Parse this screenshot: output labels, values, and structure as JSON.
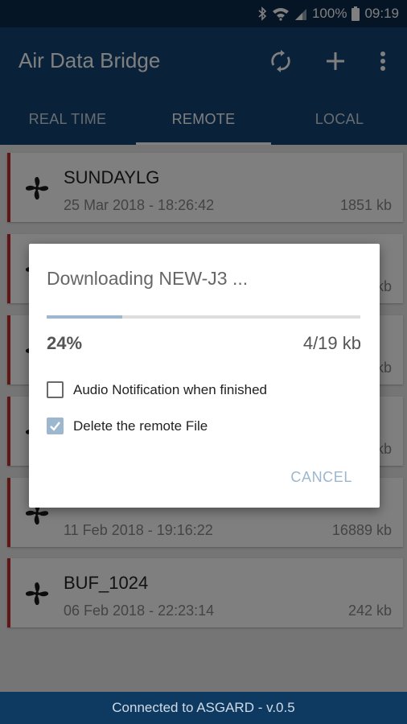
{
  "status_bar": {
    "battery": "100%",
    "time": "09:19"
  },
  "app_bar": {
    "title": "Air Data Bridge",
    "icons": [
      "sync-icon",
      "add-icon",
      "more-vert-icon"
    ]
  },
  "tabs": [
    {
      "label": "REAL TIME",
      "active": false
    },
    {
      "label": "REMOTE",
      "active": true
    },
    {
      "label": "LOCAL",
      "active": false
    }
  ],
  "files": [
    {
      "name": "SUNDAYLG",
      "date": "25 Mar 2018 - 18:26:42",
      "size": "1851 kb"
    },
    {
      "name": "",
      "date": "",
      "size": "kb"
    },
    {
      "name": "",
      "date": "",
      "size": "kb"
    },
    {
      "name": "",
      "date": "",
      "size": "kb"
    },
    {
      "name": "",
      "date": "11 Feb 2018 - 19:16:22",
      "size": "16889 kb"
    },
    {
      "name": "BUF_1024",
      "date": "06 Feb 2018 - 22:23:14",
      "size": "242 kb"
    }
  ],
  "dialog": {
    "title": "Downloading NEW-J3 ...",
    "progress_fraction": 0.24,
    "percent": "24%",
    "bytes": "4/19 kb",
    "options": [
      {
        "label": "Audio Notification when finished",
        "checked": false
      },
      {
        "label": "Delete the remote File",
        "checked": true
      }
    ],
    "cancel_label": "CANCEL"
  },
  "footer": {
    "text": "Connected to ASGARD - v.0.5"
  }
}
